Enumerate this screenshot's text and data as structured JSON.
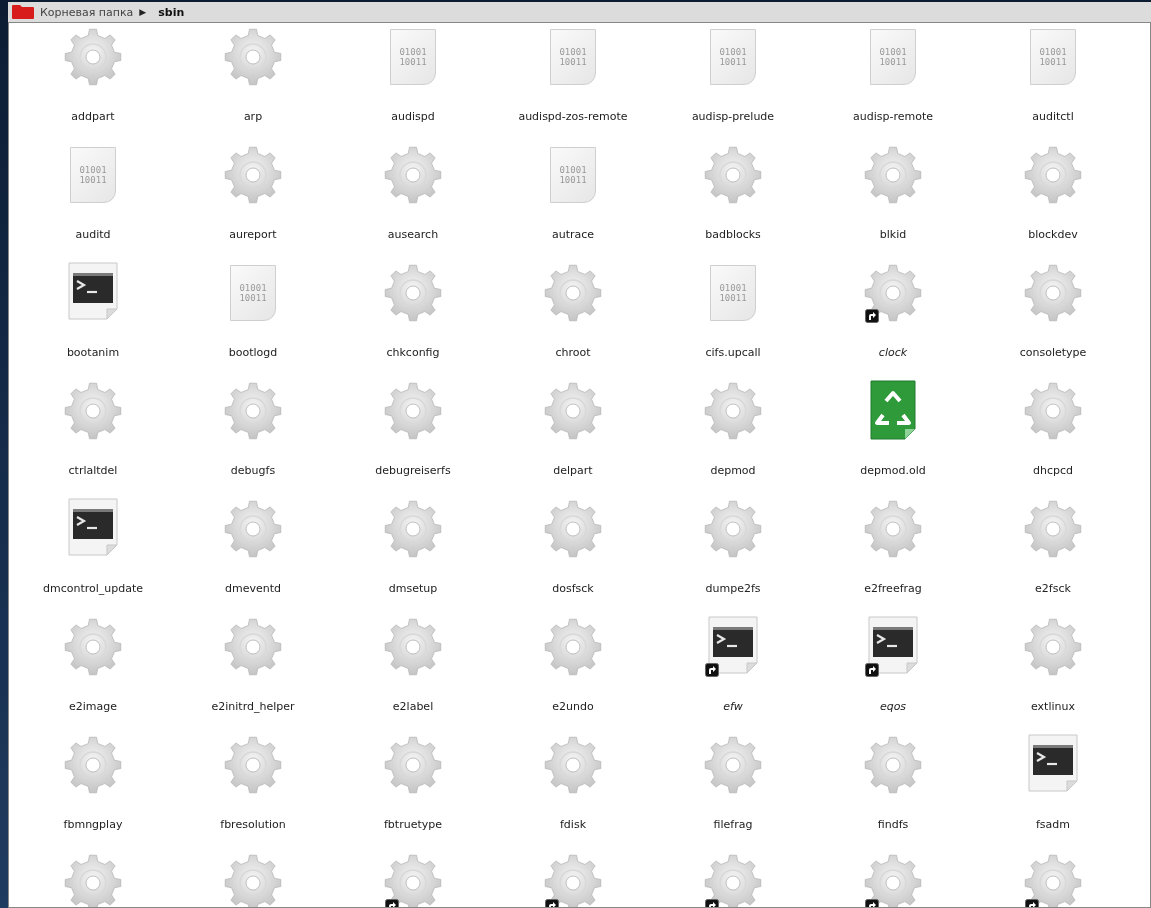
{
  "breadcrumb": {
    "root": "Корневая папка",
    "separator": "▶",
    "current": "sbin"
  },
  "files": [
    {
      "name": "addpart",
      "kind": "gear",
      "link": false
    },
    {
      "name": "arp",
      "kind": "gear",
      "link": false
    },
    {
      "name": "audispd",
      "kind": "binary",
      "link": false,
      "icon_text": [
        "01001",
        "10011"
      ]
    },
    {
      "name": "audispd-zos-remote",
      "kind": "binary",
      "link": false,
      "icon_text": [
        "01001",
        "10011"
      ]
    },
    {
      "name": "audisp-prelude",
      "kind": "binary",
      "link": false,
      "icon_text": [
        "01001",
        "10011"
      ]
    },
    {
      "name": "audisp-remote",
      "kind": "binary",
      "link": false,
      "icon_text": [
        "01001",
        "10011"
      ]
    },
    {
      "name": "auditctl",
      "kind": "binary",
      "link": false,
      "icon_text": [
        "01001",
        "10011"
      ]
    },
    {
      "name": "auditd",
      "kind": "binary",
      "link": false,
      "icon_text": [
        "01001",
        "10011"
      ]
    },
    {
      "name": "aureport",
      "kind": "gear",
      "link": false
    },
    {
      "name": "ausearch",
      "kind": "gear",
      "link": false
    },
    {
      "name": "autrace",
      "kind": "binary",
      "link": false,
      "icon_text": [
        "01001",
        "10011"
      ]
    },
    {
      "name": "badblocks",
      "kind": "gear",
      "link": false
    },
    {
      "name": "blkid",
      "kind": "gear",
      "link": false
    },
    {
      "name": "blockdev",
      "kind": "gear",
      "link": false
    },
    {
      "name": "bootanim",
      "kind": "terminal",
      "link": false
    },
    {
      "name": "bootlogd",
      "kind": "binary",
      "link": false,
      "icon_text": [
        "01001",
        "10011"
      ]
    },
    {
      "name": "chkconfig",
      "kind": "gear",
      "link": false
    },
    {
      "name": "chroot",
      "kind": "gear",
      "link": false
    },
    {
      "name": "cifs.upcall",
      "kind": "binary",
      "link": false,
      "icon_text": [
        "01001",
        "10011"
      ]
    },
    {
      "name": "clock",
      "kind": "gear",
      "link": true
    },
    {
      "name": "consoletype",
      "kind": "gear",
      "link": false
    },
    {
      "name": "ctrlaltdel",
      "kind": "gear",
      "link": false
    },
    {
      "name": "debugfs",
      "kind": "gear",
      "link": false
    },
    {
      "name": "debugreiserfs",
      "kind": "gear",
      "link": false
    },
    {
      "name": "delpart",
      "kind": "gear",
      "link": false
    },
    {
      "name": "depmod",
      "kind": "gear",
      "link": false
    },
    {
      "name": "depmod.old",
      "kind": "recycle",
      "link": false
    },
    {
      "name": "dhcpcd",
      "kind": "gear",
      "link": false
    },
    {
      "name": "dmcontrol_update",
      "kind": "terminal",
      "link": false
    },
    {
      "name": "dmeventd",
      "kind": "gear",
      "link": false
    },
    {
      "name": "dmsetup",
      "kind": "gear",
      "link": false
    },
    {
      "name": "dosfsck",
      "kind": "gear",
      "link": false
    },
    {
      "name": "dumpe2fs",
      "kind": "gear",
      "link": false
    },
    {
      "name": "e2freefrag",
      "kind": "gear",
      "link": false
    },
    {
      "name": "e2fsck",
      "kind": "gear",
      "link": false
    },
    {
      "name": "e2image",
      "kind": "gear",
      "link": false
    },
    {
      "name": "e2initrd_helper",
      "kind": "gear",
      "link": false
    },
    {
      "name": "e2label",
      "kind": "gear",
      "link": false
    },
    {
      "name": "e2undo",
      "kind": "gear",
      "link": false
    },
    {
      "name": "efw",
      "kind": "terminal",
      "link": true
    },
    {
      "name": "eqos",
      "kind": "terminal",
      "link": true
    },
    {
      "name": "extlinux",
      "kind": "gear",
      "link": false
    },
    {
      "name": "fbmngplay",
      "kind": "gear",
      "link": false
    },
    {
      "name": "fbresolution",
      "kind": "gear",
      "link": false
    },
    {
      "name": "fbtruetype",
      "kind": "gear",
      "link": false
    },
    {
      "name": "fdisk",
      "kind": "gear",
      "link": false
    },
    {
      "name": "filefrag",
      "kind": "gear",
      "link": false
    },
    {
      "name": "findfs",
      "kind": "gear",
      "link": false
    },
    {
      "name": "fsadm",
      "kind": "terminal",
      "link": false
    },
    {
      "kind": "gear",
      "link": false
    },
    {
      "kind": "gear",
      "link": false
    },
    {
      "kind": "gear",
      "link": true
    },
    {
      "kind": "gear",
      "link": true
    },
    {
      "kind": "gear",
      "link": true
    },
    {
      "kind": "gear",
      "link": true
    },
    {
      "kind": "gear",
      "link": true
    }
  ]
}
